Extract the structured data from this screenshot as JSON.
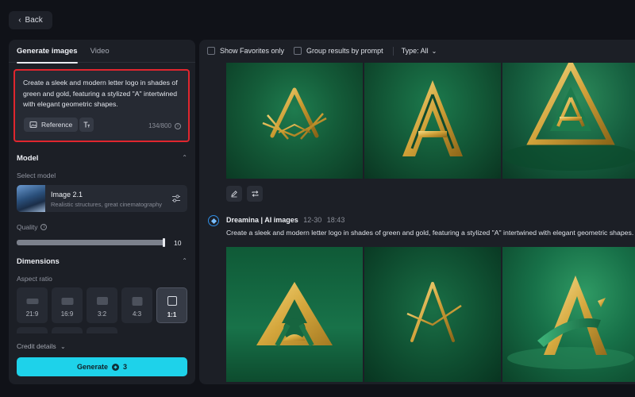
{
  "back": {
    "label": "Back"
  },
  "left": {
    "tabs": [
      {
        "label": "Generate images",
        "active": true
      },
      {
        "label": "Video",
        "active": false
      }
    ],
    "prompt": {
      "text": "Create a sleek and modern letter logo in shades of green and gold, featuring a stylized \"A\" intertwined with elegant geometric shapes.",
      "reference_label": "Reference",
      "counter": "134/800"
    },
    "model": {
      "heading": "Model",
      "select_label": "Select model",
      "name": "Image 2.1",
      "description": "Realistic structures, great cinematography"
    },
    "quality": {
      "label": "Quality",
      "value": "10",
      "level_fraction": 1.0
    },
    "dimensions": {
      "heading": "Dimensions",
      "aspect_label": "Aspect ratio",
      "ratios": [
        {
          "label": "21:9"
        },
        {
          "label": "16:9"
        },
        {
          "label": "3:2"
        },
        {
          "label": "4:3"
        },
        {
          "label": "1:1"
        }
      ],
      "selected": "1:1"
    },
    "credit_label": "Credit details",
    "generate": {
      "label": "Generate",
      "cost": "3"
    }
  },
  "right": {
    "toolbar": {
      "favorites_label": "Show Favorites only",
      "group_label": "Group results by prompt",
      "type_label": "Type: All"
    },
    "entry": {
      "title": "Dreamina | AI images",
      "date": "12-30",
      "time": "18:43",
      "prompt": "Create a sleek and modern letter logo in shades of green and gold, featuring a stylized \"A\" intertwined with elegant geometric shapes."
    }
  },
  "colors": {
    "accent": "#1ed2ea",
    "highlight_border": "#e0262e",
    "gold": "#d9b24a",
    "panel": "#1c1f26",
    "background": "#101218"
  }
}
